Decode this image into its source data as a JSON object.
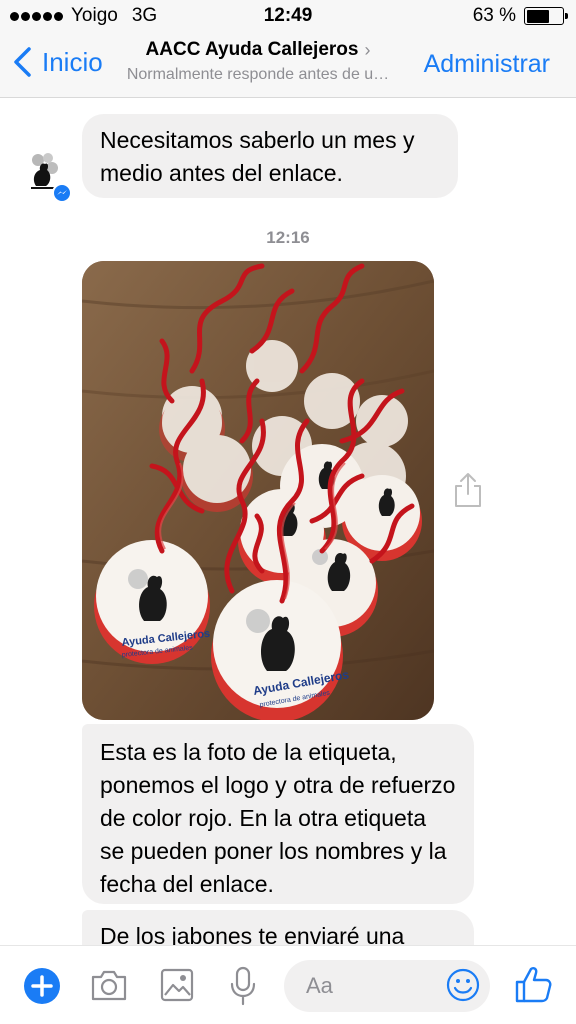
{
  "status_bar": {
    "carrier": "Yoigo",
    "network": "3G",
    "time": "12:49",
    "battery_percent_label": "63 %",
    "battery_level": 0.63
  },
  "nav": {
    "back_label": "Inicio",
    "title": "AACC Ayuda Callejeros",
    "title_chevron": "›",
    "subtitle": "Normalmente responde antes de u…",
    "admin_label": "Administrar"
  },
  "messages": [
    {
      "text": "Necesitamos saberlo un mes y medio antes del enlace."
    },
    {
      "timestamp": "12:16"
    },
    {
      "type": "photo"
    },
    {
      "text": "Esta es la foto de la etiqueta, ponemos el logo y otra de refuerzo de color rojo. En la otra etiqueta se pueden poner los nombres y la fecha del enlace."
    },
    {
      "text": "De los jabones te enviaré una"
    }
  ],
  "tag": {
    "brand": "Ayuda Callejeros",
    "tagline": "protectora de animales",
    "vertical": "AACC"
  },
  "composer": {
    "placeholder": "Aa"
  },
  "colors": {
    "accent": "#1a7cf5",
    "bubble": "#f1f0f0",
    "ribbon": "#c4141c"
  },
  "icons": [
    "back-chevron-icon",
    "plus-icon",
    "camera-icon",
    "gallery-icon",
    "microphone-icon",
    "emoji-icon",
    "thumbs-up-icon",
    "share-icon",
    "messenger-icon"
  ]
}
